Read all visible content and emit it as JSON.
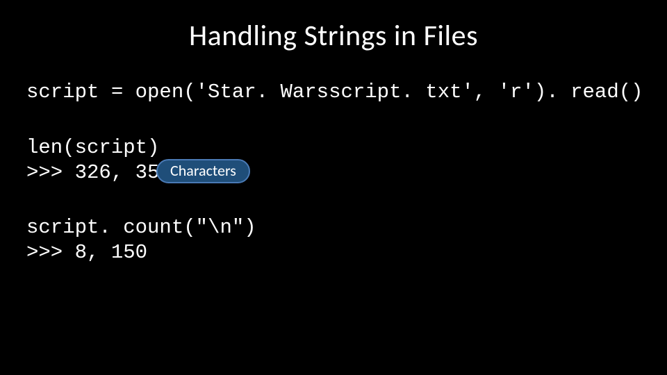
{
  "title": "Handling Strings in Files",
  "code": {
    "line1": "script = open('Star. Warsscript. txt', 'r'). read()",
    "block2": "len(script)\n>>> 326, 359",
    "block3": "script. count(\"\\n\")\n>>> 8, 150"
  },
  "badge": {
    "characters": "Characters"
  }
}
